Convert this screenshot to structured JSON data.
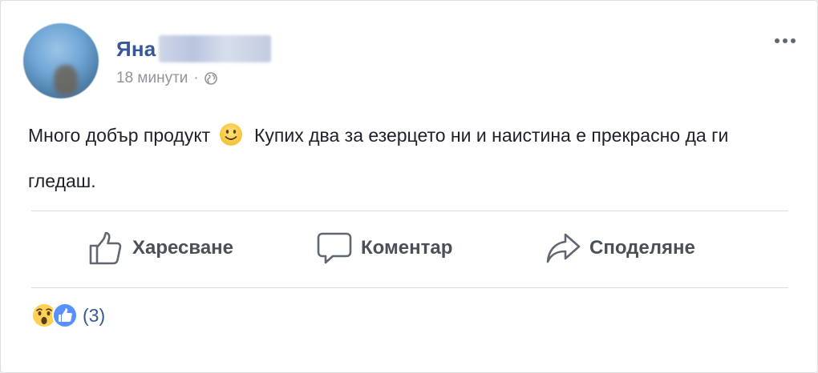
{
  "post": {
    "author_name": "Яна",
    "time": "18 минути",
    "separator": "·",
    "privacy_icon": "globe-icon",
    "text_part1": "Много добър продукт",
    "emoji_icon": "slightly-smiling-face-icon",
    "text_part2": "Купих два за езерцето ни и наистина е прекрасно да ги гледаш.",
    "more_icon": "more-options-icon"
  },
  "actions": [
    {
      "label": "Харесване",
      "icon": "thumbs-up-icon"
    },
    {
      "label": "Коментар",
      "icon": "comment-icon"
    },
    {
      "label": "Споделяне",
      "icon": "share-icon"
    }
  ],
  "reactions": {
    "icons": [
      "wow-reaction-icon",
      "like-reaction-icon"
    ],
    "count": "(3)"
  },
  "colors": {
    "author_link": "#365899",
    "meta_gray": "#90949c",
    "action_gray": "#4b4f56",
    "like_blue": "#5890ff",
    "emoji_yellow": "#fcd155"
  }
}
